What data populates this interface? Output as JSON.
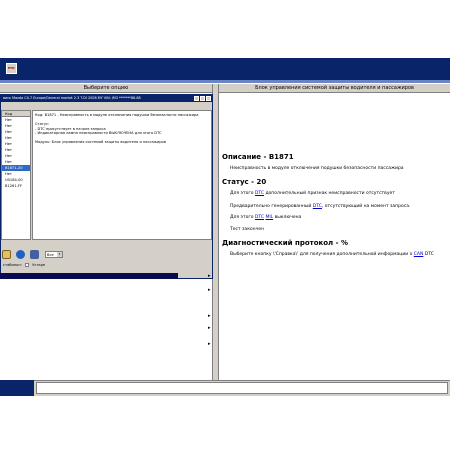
{
  "app": {
    "logo_text": "ETD"
  },
  "left_header": {
    "title": "Выберите опцию"
  },
  "right_header": {
    "title": "Блок управления системой защиты водителя и пассажиров"
  },
  "inner_window": {
    "title": "вись Mazda CX-7 Europe/General market 2.3 T-DI 2008 MY VIN: JM3 *******88-88",
    "list_header": "Код",
    "codes": [
      "Нет",
      "Нет",
      "Нет",
      "Нет",
      "Нет",
      "Нет",
      "Нет",
      "Нет",
      "B1871-20",
      "Нет",
      "U0184-00",
      "B1261-FF"
    ],
    "selected_index": 8,
    "detail_lines": [
      "Код: B1871 - Неисправность в модуле отключения подушки безопасности пассажира",
      "",
      "Статус:",
      "- DTC присутствует в начале запроса",
      "- Индикаторная лампа неисправности ВЫКЛЮЧЕНА для этого DTC",
      "",
      "Модуль: Блок управления системой защиты водителя и пассажиров"
    ],
    "select_value": "Все",
    "status_left": "стабильн:",
    "status_right": "Устаре"
  },
  "right_content": {
    "desc_title": "Описание - B1871",
    "desc_text": "Неисправность в модуле отключения подушки безопасности пассажира",
    "status_title": "Статус - 20",
    "line1_pre": "Для этого ",
    "line1_link": "DTC",
    "line1_post": " дополнительный признак неисправности отсутствует",
    "line2_pre": "Предварительно генерированный ",
    "line2_link": "DTC",
    "line2_post": ", отсутствующий на момент запроса.",
    "line3_pre": "Для этого ",
    "line3_link1": "DTC",
    "line3_link2": "MIL",
    "line3_post": " выключена",
    "line4": "Тест закончен",
    "diag_title": "Диагностический протокол - %",
    "footer_text": "Выберите кнопку \\'Справка\\' для получения дополнительной информации о ",
    "footer_link": "CAN",
    "footer_tail": " DTC"
  },
  "colors": {
    "title_bar": "#0a246a",
    "selection": "#316ac5",
    "panel_bg": "#d4d0c8",
    "link": "#0000cc"
  },
  "icons": [
    "print-icon",
    "info-icon",
    "save-icon",
    "dropdown-arrow-icon",
    "expand-arrow-icon"
  ]
}
